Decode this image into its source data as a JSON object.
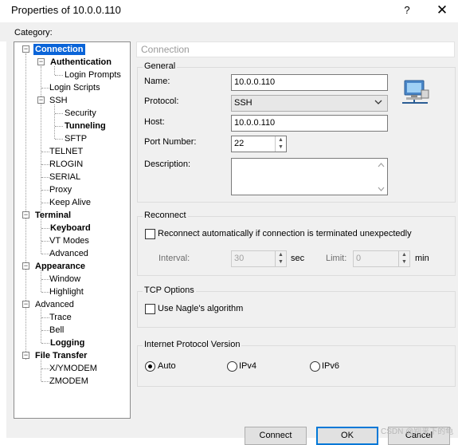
{
  "window": {
    "title": "Properties of 10.0.0.110",
    "help": "?",
    "close": "✕"
  },
  "category_label": "Category:",
  "tree": [
    {
      "label": "Connection",
      "expander": "−",
      "selected": true
    },
    {
      "label": "Authentication",
      "expander": "−"
    },
    {
      "label": "Login Prompts"
    },
    {
      "label": "Login Scripts"
    },
    {
      "label": "SSH",
      "expander": "−"
    },
    {
      "label": "Security"
    },
    {
      "label": "Tunneling"
    },
    {
      "label": "SFTP"
    },
    {
      "label": "TELNET"
    },
    {
      "label": "RLOGIN"
    },
    {
      "label": "SERIAL"
    },
    {
      "label": "Proxy"
    },
    {
      "label": "Keep Alive"
    },
    {
      "label": "Terminal",
      "expander": "−"
    },
    {
      "label": "Keyboard"
    },
    {
      "label": "VT Modes"
    },
    {
      "label": "Advanced"
    },
    {
      "label": "Appearance",
      "expander": "−"
    },
    {
      "label": "Window"
    },
    {
      "label": "Highlight"
    },
    {
      "label": "Advanced",
      "expander": "−"
    },
    {
      "label": "Trace"
    },
    {
      "label": "Bell"
    },
    {
      "label": "Logging"
    },
    {
      "label": "File Transfer",
      "expander": "−"
    },
    {
      "label": "X/YMODEM"
    },
    {
      "label": "ZMODEM"
    }
  ],
  "panel_title": "Connection",
  "general": {
    "label": "General",
    "name_label": "Name:",
    "name_value": "10.0.0.110",
    "protocol_label": "Protocol:",
    "protocol_value": "SSH",
    "host_label": "Host:",
    "host_value": "10.0.0.110",
    "port_label": "Port Number:",
    "port_value": "22",
    "description_label": "Description:",
    "icon": "network-computer-icon"
  },
  "reconnect": {
    "label": "Reconnect",
    "checkbox_label": "Reconnect automatically if connection is terminated unexpectedly",
    "checked": false,
    "interval_label": "Interval:",
    "interval_value": "30",
    "interval_unit": "sec",
    "limit_label": "Limit:",
    "limit_value": "0",
    "limit_unit": "min"
  },
  "tcp": {
    "label": "TCP Options",
    "nagle_label": "Use Nagle's algorithm",
    "checked": false
  },
  "ip": {
    "label": "Internet Protocol Version",
    "options": [
      "Auto",
      "IPv4",
      "IPv6"
    ],
    "selected": "Auto"
  },
  "buttons": {
    "connect": "Connect",
    "ok": "OK",
    "cancel": "Cancel"
  },
  "watermark": "CSDN @别来下的龟",
  "colors": {
    "selection": "#0a64d8",
    "default_button_border": "#0078d7"
  }
}
